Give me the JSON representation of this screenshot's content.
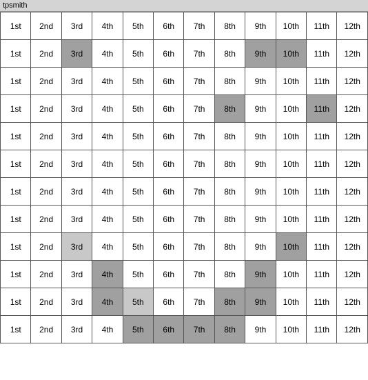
{
  "title": "tpsmith",
  "columns": [
    "1st",
    "2nd",
    "3rd",
    "4th",
    "5th",
    "6th",
    "7th",
    "8th",
    "9th",
    "10th",
    "11th",
    "12th"
  ],
  "rows": [
    {
      "cells": [
        {
          "text": "1st",
          "style": ""
        },
        {
          "text": "2nd",
          "style": ""
        },
        {
          "text": "3rd",
          "style": ""
        },
        {
          "text": "4th",
          "style": ""
        },
        {
          "text": "5th",
          "style": ""
        },
        {
          "text": "6th",
          "style": ""
        },
        {
          "text": "7th",
          "style": ""
        },
        {
          "text": "8th",
          "style": ""
        },
        {
          "text": "9th",
          "style": ""
        },
        {
          "text": "10th",
          "style": ""
        },
        {
          "text": "11th",
          "style": ""
        },
        {
          "text": "12th",
          "style": ""
        }
      ]
    },
    {
      "cells": [
        {
          "text": "1st",
          "style": ""
        },
        {
          "text": "2nd",
          "style": ""
        },
        {
          "text": "3rd",
          "style": "highlight-gray"
        },
        {
          "text": "4th",
          "style": ""
        },
        {
          "text": "5th",
          "style": ""
        },
        {
          "text": "6th",
          "style": ""
        },
        {
          "text": "7th",
          "style": ""
        },
        {
          "text": "8th",
          "style": ""
        },
        {
          "text": "9th",
          "style": "highlight-gray"
        },
        {
          "text": "10th",
          "style": "highlight-gray"
        },
        {
          "text": "11th",
          "style": ""
        },
        {
          "text": "12th",
          "style": ""
        }
      ]
    },
    {
      "cells": [
        {
          "text": "1st",
          "style": ""
        },
        {
          "text": "2nd",
          "style": ""
        },
        {
          "text": "3rd",
          "style": ""
        },
        {
          "text": "4th",
          "style": ""
        },
        {
          "text": "5th",
          "style": ""
        },
        {
          "text": "6th",
          "style": ""
        },
        {
          "text": "7th",
          "style": ""
        },
        {
          "text": "8th",
          "style": ""
        },
        {
          "text": "9th",
          "style": ""
        },
        {
          "text": "10th",
          "style": ""
        },
        {
          "text": "11th",
          "style": ""
        },
        {
          "text": "12th",
          "style": ""
        }
      ]
    },
    {
      "cells": [
        {
          "text": "1st",
          "style": ""
        },
        {
          "text": "2nd",
          "style": ""
        },
        {
          "text": "3rd",
          "style": ""
        },
        {
          "text": "4th",
          "style": ""
        },
        {
          "text": "5th",
          "style": ""
        },
        {
          "text": "6th",
          "style": ""
        },
        {
          "text": "7th",
          "style": ""
        },
        {
          "text": "8th",
          "style": "highlight-gray"
        },
        {
          "text": "9th",
          "style": ""
        },
        {
          "text": "10th",
          "style": ""
        },
        {
          "text": "11th",
          "style": "highlight-gray"
        },
        {
          "text": "12th",
          "style": ""
        }
      ]
    },
    {
      "cells": [
        {
          "text": "1st",
          "style": ""
        },
        {
          "text": "2nd",
          "style": ""
        },
        {
          "text": "3rd",
          "style": ""
        },
        {
          "text": "4th",
          "style": ""
        },
        {
          "text": "5th",
          "style": ""
        },
        {
          "text": "6th",
          "style": ""
        },
        {
          "text": "7th",
          "style": ""
        },
        {
          "text": "8th",
          "style": ""
        },
        {
          "text": "9th",
          "style": ""
        },
        {
          "text": "10th",
          "style": ""
        },
        {
          "text": "11th",
          "style": ""
        },
        {
          "text": "12th",
          "style": ""
        }
      ]
    },
    {
      "cells": [
        {
          "text": "1st",
          "style": ""
        },
        {
          "text": "2nd",
          "style": ""
        },
        {
          "text": "3rd",
          "style": ""
        },
        {
          "text": "4th",
          "style": ""
        },
        {
          "text": "5th",
          "style": ""
        },
        {
          "text": "6th",
          "style": ""
        },
        {
          "text": "7th",
          "style": ""
        },
        {
          "text": "8th",
          "style": ""
        },
        {
          "text": "9th",
          "style": ""
        },
        {
          "text": "10th",
          "style": ""
        },
        {
          "text": "11th",
          "style": ""
        },
        {
          "text": "12th",
          "style": ""
        }
      ]
    },
    {
      "cells": [
        {
          "text": "1st",
          "style": ""
        },
        {
          "text": "2nd",
          "style": ""
        },
        {
          "text": "3rd",
          "style": ""
        },
        {
          "text": "4th",
          "style": ""
        },
        {
          "text": "5th",
          "style": ""
        },
        {
          "text": "6th",
          "style": ""
        },
        {
          "text": "7th",
          "style": ""
        },
        {
          "text": "8th",
          "style": ""
        },
        {
          "text": "9th",
          "style": ""
        },
        {
          "text": "10th",
          "style": ""
        },
        {
          "text": "11th",
          "style": ""
        },
        {
          "text": "12th",
          "style": ""
        }
      ]
    },
    {
      "cells": [
        {
          "text": "1st",
          "style": ""
        },
        {
          "text": "2nd",
          "style": ""
        },
        {
          "text": "3rd",
          "style": ""
        },
        {
          "text": "4th",
          "style": ""
        },
        {
          "text": "5th",
          "style": ""
        },
        {
          "text": "6th",
          "style": ""
        },
        {
          "text": "7th",
          "style": ""
        },
        {
          "text": "8th",
          "style": ""
        },
        {
          "text": "9th",
          "style": ""
        },
        {
          "text": "10th",
          "style": ""
        },
        {
          "text": "11th",
          "style": ""
        },
        {
          "text": "12th",
          "style": ""
        }
      ]
    },
    {
      "cells": [
        {
          "text": "1st",
          "style": ""
        },
        {
          "text": "2nd",
          "style": ""
        },
        {
          "text": "3rd",
          "style": "highlight-light"
        },
        {
          "text": "4th",
          "style": ""
        },
        {
          "text": "5th",
          "style": ""
        },
        {
          "text": "6th",
          "style": ""
        },
        {
          "text": "7th",
          "style": ""
        },
        {
          "text": "8th",
          "style": ""
        },
        {
          "text": "9th",
          "style": ""
        },
        {
          "text": "10th",
          "style": "highlight-gray"
        },
        {
          "text": "11th",
          "style": ""
        },
        {
          "text": "12th",
          "style": ""
        }
      ]
    },
    {
      "cells": [
        {
          "text": "1st",
          "style": ""
        },
        {
          "text": "2nd",
          "style": ""
        },
        {
          "text": "3rd",
          "style": ""
        },
        {
          "text": "4th",
          "style": "highlight-gray"
        },
        {
          "text": "5th",
          "style": ""
        },
        {
          "text": "6th",
          "style": ""
        },
        {
          "text": "7th",
          "style": ""
        },
        {
          "text": "8th",
          "style": ""
        },
        {
          "text": "9th",
          "style": "highlight-gray"
        },
        {
          "text": "10th",
          "style": ""
        },
        {
          "text": "11th",
          "style": ""
        },
        {
          "text": "12th",
          "style": ""
        }
      ]
    },
    {
      "cells": [
        {
          "text": "1st",
          "style": ""
        },
        {
          "text": "2nd",
          "style": ""
        },
        {
          "text": "3rd",
          "style": ""
        },
        {
          "text": "4th",
          "style": "highlight-gray"
        },
        {
          "text": "5th",
          "style": "highlight-light"
        },
        {
          "text": "6th",
          "style": ""
        },
        {
          "text": "7th",
          "style": ""
        },
        {
          "text": "8th",
          "style": "highlight-gray"
        },
        {
          "text": "9th",
          "style": "highlight-gray"
        },
        {
          "text": "10th",
          "style": ""
        },
        {
          "text": "11th",
          "style": ""
        },
        {
          "text": "12th",
          "style": ""
        }
      ]
    },
    {
      "cells": [
        {
          "text": "1st",
          "style": ""
        },
        {
          "text": "2nd",
          "style": ""
        },
        {
          "text": "3rd",
          "style": ""
        },
        {
          "text": "4th",
          "style": ""
        },
        {
          "text": "5th",
          "style": "highlight-gray"
        },
        {
          "text": "6th",
          "style": "highlight-gray"
        },
        {
          "text": "7th",
          "style": "highlight-gray"
        },
        {
          "text": "8th",
          "style": "highlight-gray"
        },
        {
          "text": "9th",
          "style": ""
        },
        {
          "text": "10th",
          "style": ""
        },
        {
          "text": "11th",
          "style": ""
        },
        {
          "text": "12th",
          "style": ""
        }
      ]
    }
  ]
}
